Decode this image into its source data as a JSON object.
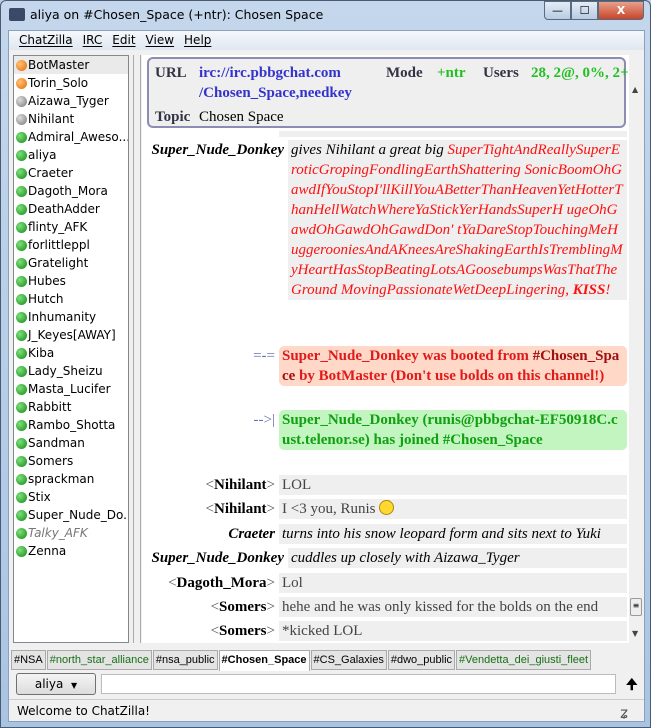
{
  "window": {
    "title": "aliya on #Chosen_Space (+ntr): Chosen Space",
    "logo": "cZ",
    "min": "—",
    "max": "☐",
    "close": "X"
  },
  "menu": [
    "ChatZilla",
    "IRC",
    "Edit",
    "View",
    "Help"
  ],
  "users": [
    {
      "name": "BotMaster",
      "status": "op",
      "color": "#e26a00"
    },
    {
      "name": "Torin_Solo",
      "status": "op",
      "color": "#e26a00"
    },
    {
      "name": "Aizawa_Tyger",
      "status": "away",
      "color": "#777777"
    },
    {
      "name": "Nihilant",
      "status": "away",
      "color": "#777777"
    },
    {
      "name": "Admiral_Aweso...",
      "status": "normal"
    },
    {
      "name": "aliya",
      "status": "normal"
    },
    {
      "name": "Craeter",
      "status": "normal"
    },
    {
      "name": "Dagoth_Mora",
      "status": "normal"
    },
    {
      "name": "DeathAdder",
      "status": "normal"
    },
    {
      "name": "flinty_AFK",
      "status": "normal"
    },
    {
      "name": "forlittleppl",
      "status": "normal"
    },
    {
      "name": "Gratelight",
      "status": "normal"
    },
    {
      "name": "Hubes",
      "status": "normal"
    },
    {
      "name": "Hutch",
      "status": "normal"
    },
    {
      "name": "Inhumanity",
      "status": "normal"
    },
    {
      "name": "J_Keyes[AWAY]",
      "status": "normal"
    },
    {
      "name": "Kiba",
      "status": "normal"
    },
    {
      "name": "Lady_Sheizu",
      "status": "normal"
    },
    {
      "name": "Masta_Lucifer",
      "status": "normal"
    },
    {
      "name": "Rabbitt",
      "status": "normal"
    },
    {
      "name": "Rambo_Shotta",
      "status": "normal"
    },
    {
      "name": "Sandman",
      "status": "normal"
    },
    {
      "name": "Somers",
      "status": "normal"
    },
    {
      "name": "sprackman",
      "status": "normal"
    },
    {
      "name": "Stix",
      "status": "normal"
    },
    {
      "name": "Super_Nude_Do...",
      "status": "normal"
    },
    {
      "name": "Talky_AFK",
      "status": "idle"
    },
    {
      "name": "Zenna",
      "status": "normal"
    }
  ],
  "header": {
    "url_label": "URL",
    "url_line1": "irc://irc.pbbgchat.com",
    "url_line2": "/Chosen_Space,needkey",
    "mode_label": "Mode",
    "mode": "+ntr",
    "users_label": "Users",
    "users": "28, 2@, 0%, 2+",
    "topic_label": "Topic",
    "topic": "Chosen Space"
  },
  "messages": {
    "m1": {
      "nick": "Super_Nude_Donkey",
      "pre": "gives Nihilant a great big ",
      "red": "SuperTightAndReallySuperEroticGropingFondlingEarthShattering SonicBoomOhGawdIfYouStopI'llKillYouABetterThanHeavenYetHotterThanHellWatchWhereYaStickYerHandsSuperH ugeOhGawdOhGawdOhGawdDon' tYaDareStopTouchingMeHuggerooniesAndAKneesAreShakingEarthIsTremblingMyHeartHasStopBeatingLotsAGoosebumpsWasThatTheGround MovingPassionateWetDeepLingering, ",
      "kiss": "KISS",
      "end": "!"
    },
    "kick": {
      "marker": "=-=",
      "who": "Super_Nude_Donkey",
      "t1": " was booted from ",
      "chan": "#Chosen_Space",
      "t2": " by BotMaster (Don't use bolds on this channel!)"
    },
    "join": {
      "marker": "-->|",
      "text": "Super_Nude_Donkey (runis@pbbgchat-EF50918C.cust.telenor.se) has joined #Chosen_Space"
    },
    "m2": {
      "nick": "Nihilant",
      "text": "LOL"
    },
    "m3": {
      "nick": "Nihilant",
      "text": "I <3 you, Runis"
    },
    "m4": {
      "nick": "Craeter",
      "text": "turns into his snow leopard form and sits next to Yuki"
    },
    "m5": {
      "nick": "Super_Nude_Donkey",
      "text": "cuddles up closely with Aizawa_Tyger"
    },
    "m6": {
      "nick": "Dagoth_Mora",
      "text": "Lol"
    },
    "m7": {
      "nick": "Somers",
      "text": "hehe and he was only kissed for the bolds on the end"
    },
    "m8": {
      "nick": "Somers",
      "text": "*kicked LOL"
    }
  },
  "tabs": [
    {
      "label": "#NSA",
      "active": false,
      "highlight": false
    },
    {
      "label": "#north_star_alliance",
      "active": false,
      "highlight": true
    },
    {
      "label": "#nsa_public",
      "active": false,
      "highlight": false
    },
    {
      "label": "#Chosen_Space",
      "active": true,
      "highlight": false
    },
    {
      "label": "#CS_Galaxies",
      "active": false,
      "highlight": false
    },
    {
      "label": "#dwo_public",
      "active": false,
      "highlight": false
    },
    {
      "label": "#Vendetta_dei_giusti_fleet",
      "active": false,
      "highlight": true
    }
  ],
  "input": {
    "nick": "aliya",
    "value": ""
  },
  "status": {
    "text": "Welcome to ChatZilla!"
  }
}
